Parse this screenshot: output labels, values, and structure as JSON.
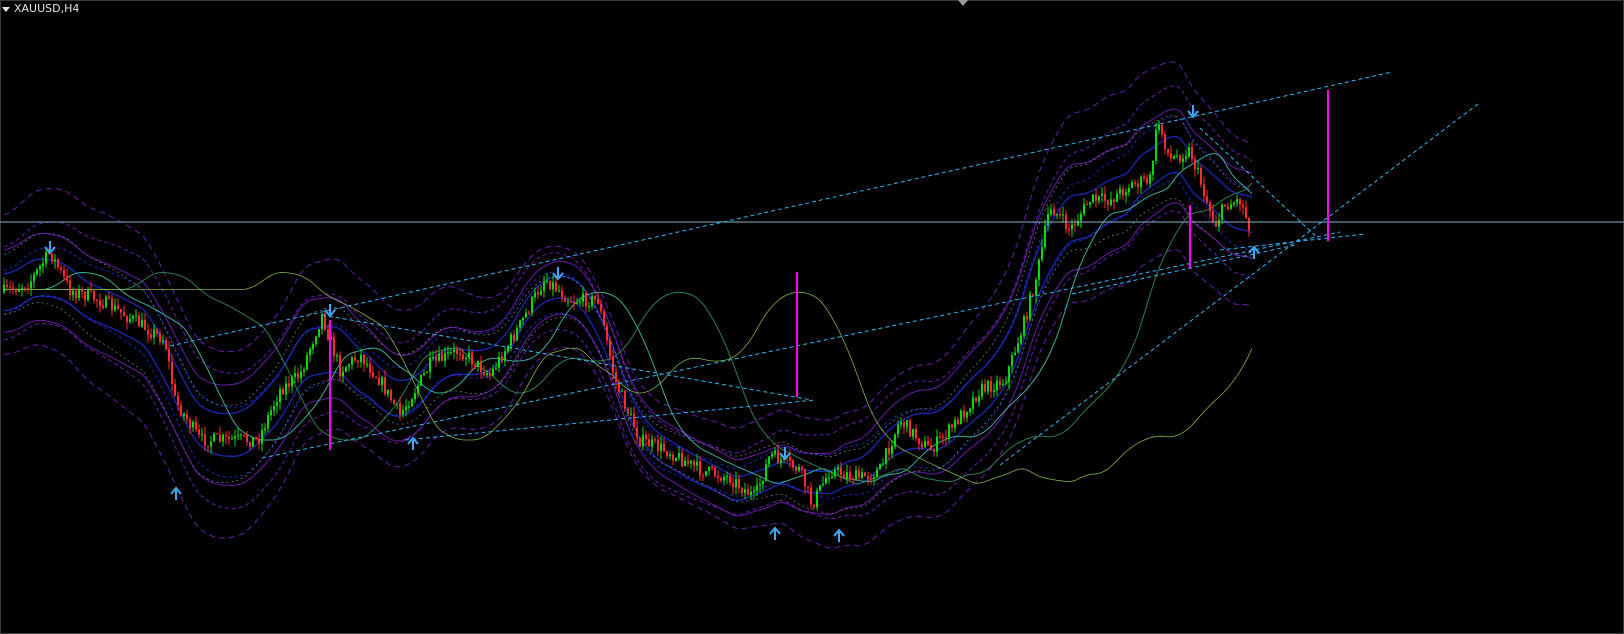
{
  "window": {
    "title": "XAUUSD,H4"
  },
  "colors": {
    "background": "#000000",
    "bull_candle": "#00dd00",
    "bear_candle": "#ff2a2a",
    "trendline": "#29b6f6",
    "price_line": "#7fb2c8",
    "target_bar": "#ff00ff",
    "signal_arrow": "#3fa9f5",
    "envelope_blue": "#1c2fd6",
    "envelope_purple": "#7a1ec8",
    "envelope_grey": "#8a8a9a",
    "ma_green": "#2e8b57"
  },
  "icons": [
    "dropdown-triangle-icon",
    "chart-shift-marker-icon",
    "arrow-up-icon",
    "arrow-down-icon"
  ]
}
